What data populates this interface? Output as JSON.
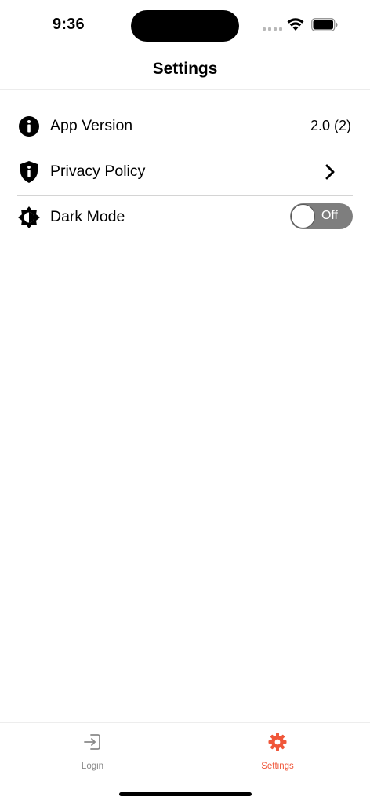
{
  "status_bar": {
    "time": "9:36"
  },
  "nav": {
    "title": "Settings"
  },
  "rows": [
    {
      "label": "App Version",
      "value": "2.0 (2)",
      "icon": "info-circle-icon"
    },
    {
      "label": "Privacy Policy",
      "icon": "shield-info-icon",
      "accessory": "chevron-right-icon"
    },
    {
      "label": "Dark Mode",
      "icon": "brightness-icon",
      "toggle": {
        "state": "Off",
        "on": false
      }
    }
  ],
  "tabbar": {
    "tabs": [
      {
        "label": "Login",
        "icon": "login-icon",
        "selected": false
      },
      {
        "label": "Settings",
        "icon": "gear-icon",
        "selected": true
      }
    ]
  },
  "colors": {
    "accent": "#f0573a",
    "inactive_tab": "#8a8a8a",
    "toggle_off": "#7e7e7e"
  }
}
